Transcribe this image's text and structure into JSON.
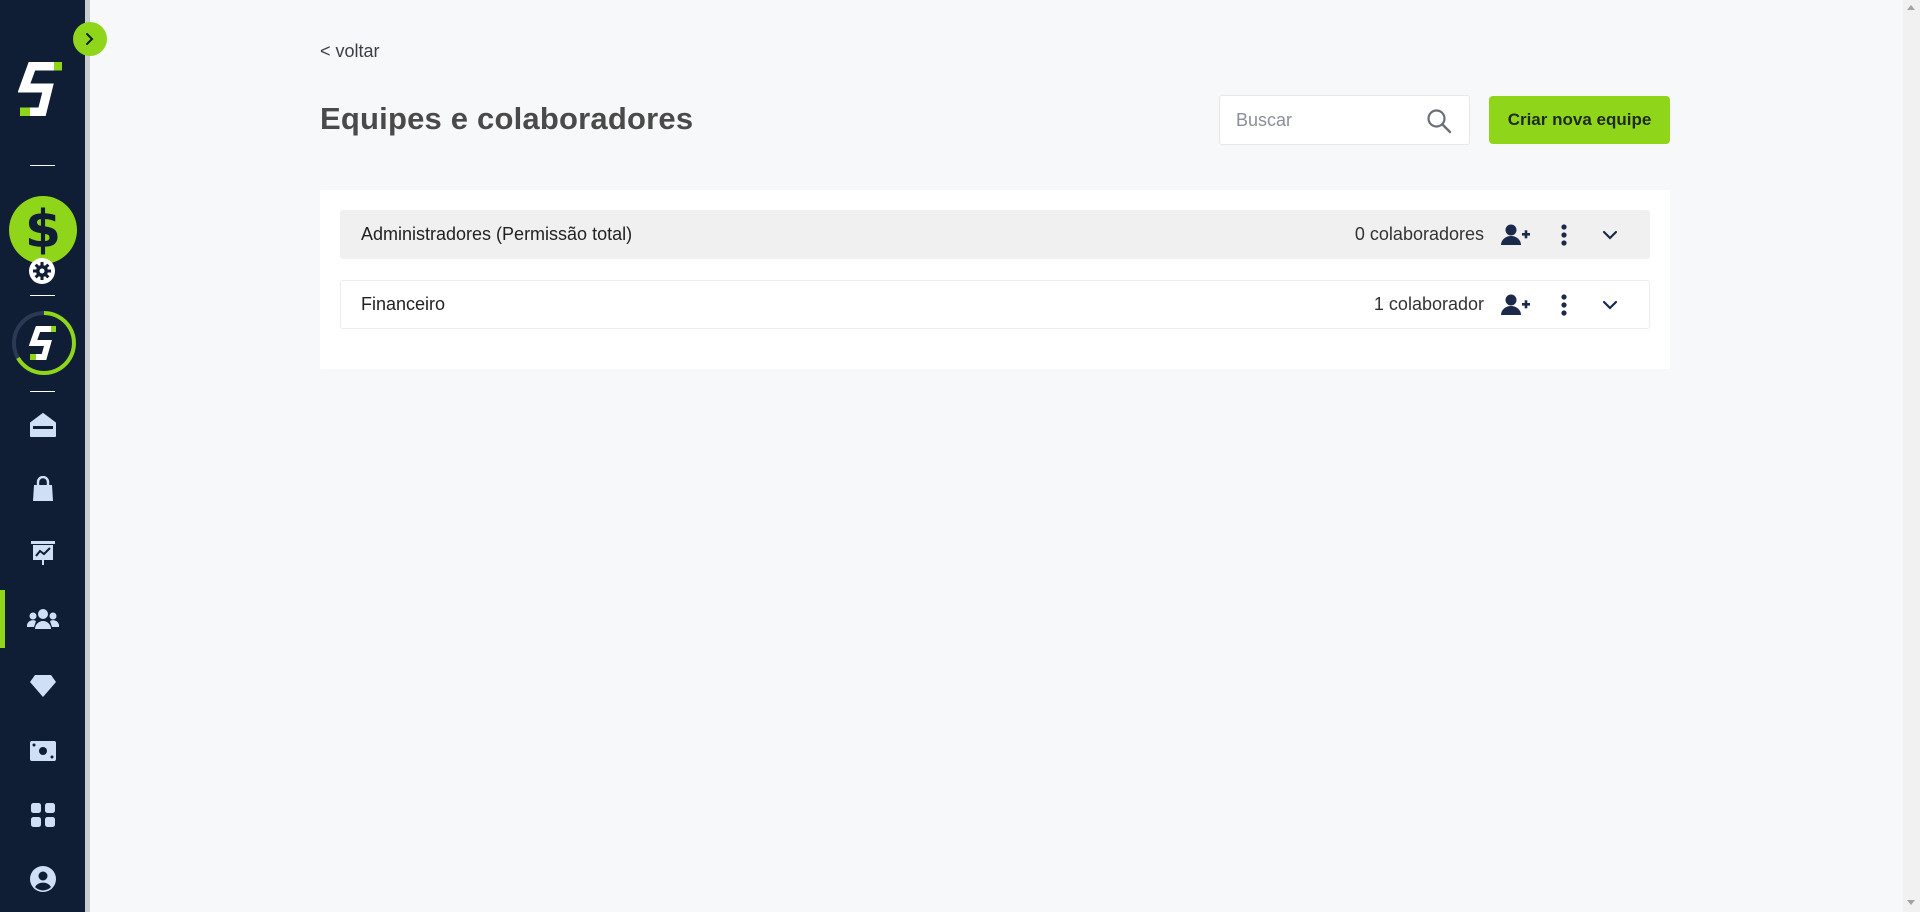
{
  "sidebar": {
    "nav_items": [
      {
        "id": "home",
        "icon": "home-icon"
      },
      {
        "id": "shop",
        "icon": "shopping-bag-icon"
      },
      {
        "id": "presentation",
        "icon": "presentation-chart-icon"
      },
      {
        "id": "teams",
        "icon": "users-icon",
        "active": true
      },
      {
        "id": "premium",
        "icon": "diamond-icon"
      },
      {
        "id": "money",
        "icon": "money-bill-icon"
      },
      {
        "id": "apps",
        "icon": "apps-grid-icon"
      },
      {
        "id": "profile",
        "icon": "user-circle-icon"
      }
    ],
    "dollar_symbol": "$"
  },
  "header": {
    "back_label": "< voltar",
    "title": "Equipes e colaboradores",
    "search_placeholder": "Buscar",
    "create_button_label": "Criar nova equipe"
  },
  "teams": [
    {
      "name": "Administradores (Permissão total)",
      "count_label": "0 colaboradores"
    },
    {
      "name": "Financeiro",
      "count_label": "1 colaborador"
    }
  ],
  "colors": {
    "sidebar_bg": "#0f1d35",
    "accent_green": "#8fd61b",
    "icon_light": "#cfe0f5",
    "icon_dark": "#1b2a4a"
  }
}
